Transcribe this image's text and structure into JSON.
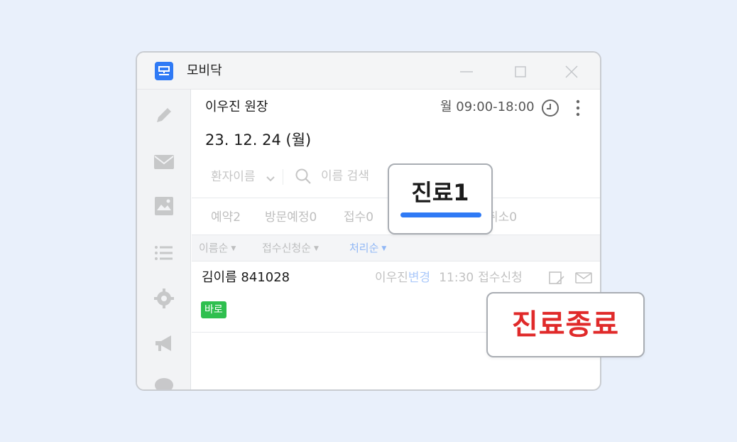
{
  "window": {
    "title": "모비닥",
    "app_icon_glyph": "모"
  },
  "sidebar": {
    "icons": [
      "pencil-icon",
      "mail-icon",
      "image-icon",
      "list-icon",
      "gear-icon",
      "megaphone-icon",
      "chat-icon"
    ]
  },
  "header": {
    "doctor": "이우진 원장",
    "hours": "월 09:00-18:00",
    "date": "23. 12. 24 (월)"
  },
  "search": {
    "filter_label": "환자이름",
    "placeholder": "이름 검색"
  },
  "tabs": [
    {
      "label": "예약2"
    },
    {
      "label": "방문예정0"
    },
    {
      "label": "접수0"
    },
    {
      "label": "취소0"
    }
  ],
  "sort": [
    {
      "label": "이름순",
      "arrow": "▼"
    },
    {
      "label": "접수신청순",
      "arrow": "▼"
    },
    {
      "label": "처리순",
      "arrow": "▼"
    }
  ],
  "patient": {
    "name": "김이름 841028",
    "doctor": "이우진",
    "change": "변경",
    "time": "11:30",
    "status": "접수신청",
    "badge": "바로"
  },
  "callouts": {
    "in_treatment": "진료1",
    "treatment_done": "진료종료"
  },
  "colors": {
    "accent": "#2f7af5",
    "badge_green": "#2fbf4f",
    "done_red": "#e02a2a",
    "background": "#e9f0fb"
  }
}
